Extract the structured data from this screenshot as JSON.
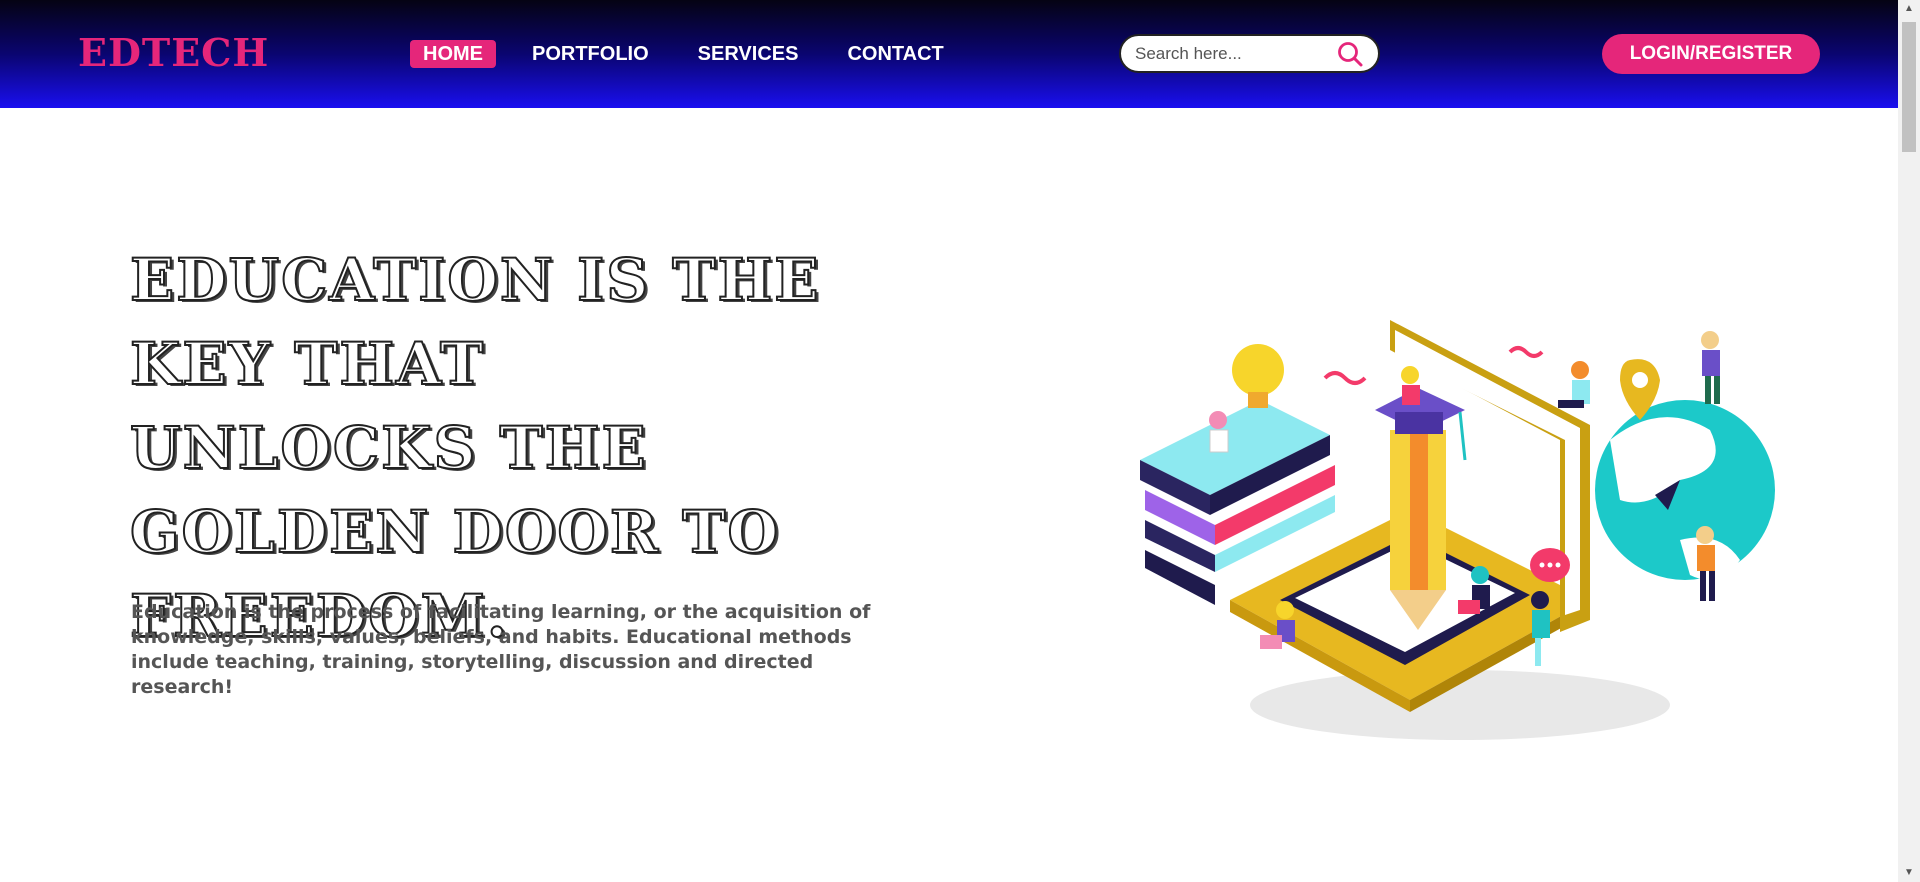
{
  "brand": {
    "logo": "EDTECH"
  },
  "nav": {
    "items": [
      {
        "label": "HOME",
        "active": true
      },
      {
        "label": "PORTFOLIO",
        "active": false
      },
      {
        "label": "SERVICES",
        "active": false
      },
      {
        "label": "CONTACT",
        "active": false
      }
    ]
  },
  "search": {
    "placeholder": "Search here...",
    "value": "",
    "icon": "search-icon"
  },
  "auth": {
    "login_label": "LOGIN/REGISTER"
  },
  "hero": {
    "headline": "EDUCATION IS THE KEY THAT UNLOCKS THE GOLDEN DOOR TO FREEDOM.",
    "description": "Education is the process of facilitating learning, or the acquisition of knowledge, skills, values, beliefs, and habits. Educational methods include teaching, training, storytelling, discussion and directed research!"
  },
  "colors": {
    "accent": "#e5267a",
    "nav_gradient_top": "#050313",
    "nav_gradient_bottom": "#1a0ff0",
    "text_dark": "#222222",
    "text_muted": "#555555"
  }
}
